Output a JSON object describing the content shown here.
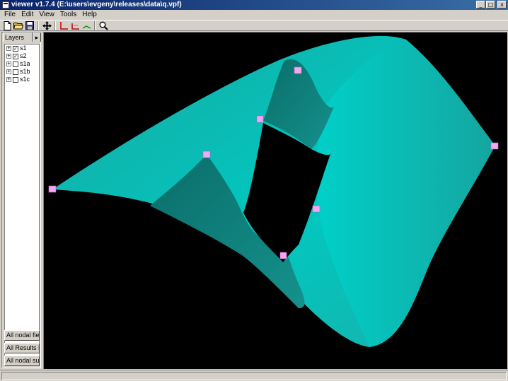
{
  "window": {
    "title": "viewer v1.7.4 (E:\\users\\evgeny\\releases\\data\\q.vpf)",
    "minimize_glyph": "_",
    "maximize_glyph": "□",
    "close_glyph": "x"
  },
  "menu": {
    "items": [
      {
        "label": "File"
      },
      {
        "label": "Edit"
      },
      {
        "label": "View"
      },
      {
        "label": "Tools"
      },
      {
        "label": "Help"
      }
    ]
  },
  "toolbar": {
    "icons": [
      "new-file-icon",
      "open-folder-icon",
      "save-icon",
      "move-icon",
      "axis-x-icon",
      "axis-y-icon",
      "axis-z-icon",
      "zoom-icon"
    ]
  },
  "sidebar": {
    "tab_label": "Layers",
    "tab_more_glyph": "▸",
    "layers": [
      {
        "label": "s1",
        "checked": true
      },
      {
        "label": "s2",
        "checked": true
      },
      {
        "label": "s1a",
        "checked": false
      },
      {
        "label": "s1b",
        "checked": false
      },
      {
        "label": "s1c",
        "checked": false
      }
    ],
    "buttons": [
      {
        "label": "All nodal fields"
      },
      {
        "label": "All Results Fiel"
      },
      {
        "label": "All nodal surf"
      }
    ]
  },
  "scene": {
    "surface_color": "#00b8b0",
    "surface_shadow_color": "#006a66",
    "background_color": "#000000",
    "node_marker_color": "#f0a8f0"
  }
}
